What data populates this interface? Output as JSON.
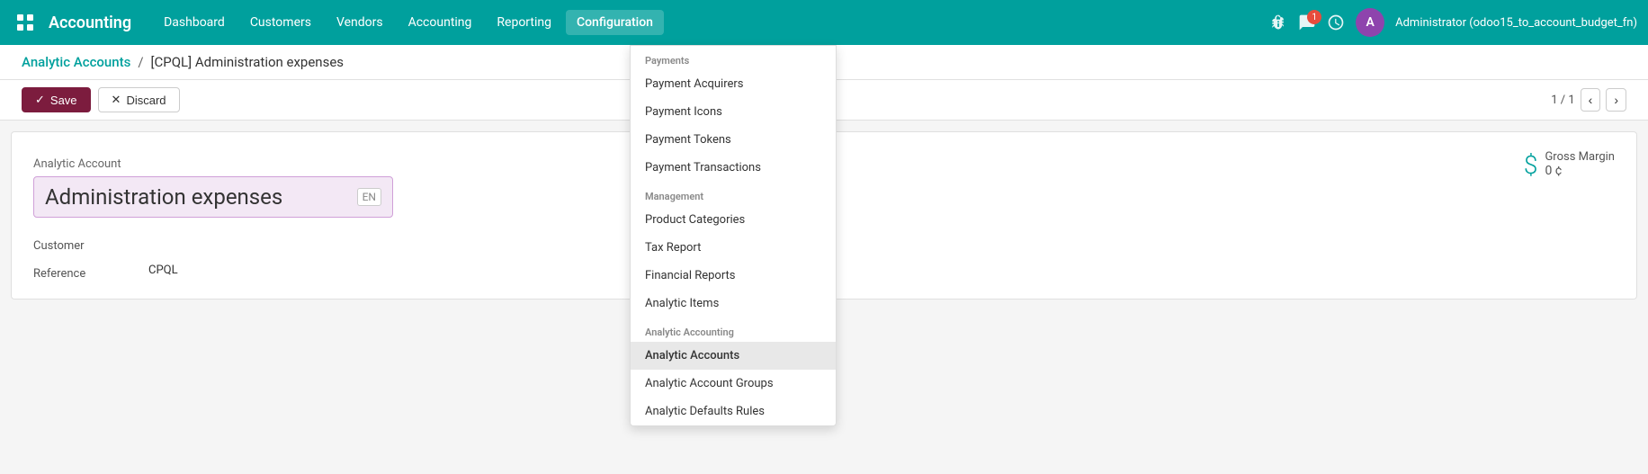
{
  "app": {
    "icon": "⊞",
    "title": "Accounting"
  },
  "nav": {
    "links": [
      {
        "label": "Dashboard",
        "active": false
      },
      {
        "label": "Customers",
        "active": false
      },
      {
        "label": "Vendors",
        "active": false
      },
      {
        "label": "Accounting",
        "active": false
      },
      {
        "label": "Reporting",
        "active": false
      },
      {
        "label": "Configuration",
        "active": true
      }
    ],
    "right": {
      "bug_icon": "🐞",
      "chat_icon": "💬",
      "notif_count": "1",
      "clock_icon": "🕐",
      "avatar_letter": "A",
      "user_name": "Administrator (odoo15_to_account_budget_fn)"
    }
  },
  "breadcrumb": {
    "parent": "Analytic Accounts",
    "separator": "/",
    "current": "[CPQL] Administration expenses"
  },
  "actions": {
    "save_label": "Save",
    "discard_label": "Discard",
    "save_icon": "✓",
    "discard_icon": "✕",
    "pagination": "1 / 1"
  },
  "form": {
    "analytic_account_label": "Analytic Account",
    "account_name": "Administration expenses",
    "en_badge": "EN",
    "customer_label": "Customer",
    "customer_value": "",
    "reference_label": "Reference",
    "reference_value": "CPQL",
    "gross_margin_label": "Gross Margin",
    "gross_margin_value": "0 ¢",
    "gross_margin_icon": "$"
  },
  "dropdown": {
    "sections": [
      {
        "header": "Payments",
        "items": [
          {
            "label": "Payment Acquirers",
            "active": false
          },
          {
            "label": "Payment Icons",
            "active": false
          },
          {
            "label": "Payment Tokens",
            "active": false
          },
          {
            "label": "Payment Transactions",
            "active": false
          }
        ]
      },
      {
        "header": "Management",
        "items": [
          {
            "label": "Product Categories",
            "active": false
          },
          {
            "label": "Tax Report",
            "active": false
          },
          {
            "label": "Financial Reports",
            "active": false
          },
          {
            "label": "Analytic Items",
            "active": false
          }
        ]
      },
      {
        "header": "Analytic Accounting",
        "items": [
          {
            "label": "Analytic Accounts",
            "active": true
          },
          {
            "label": "Analytic Account Groups",
            "active": false
          },
          {
            "label": "Analytic Defaults Rules",
            "active": false
          }
        ]
      }
    ]
  }
}
